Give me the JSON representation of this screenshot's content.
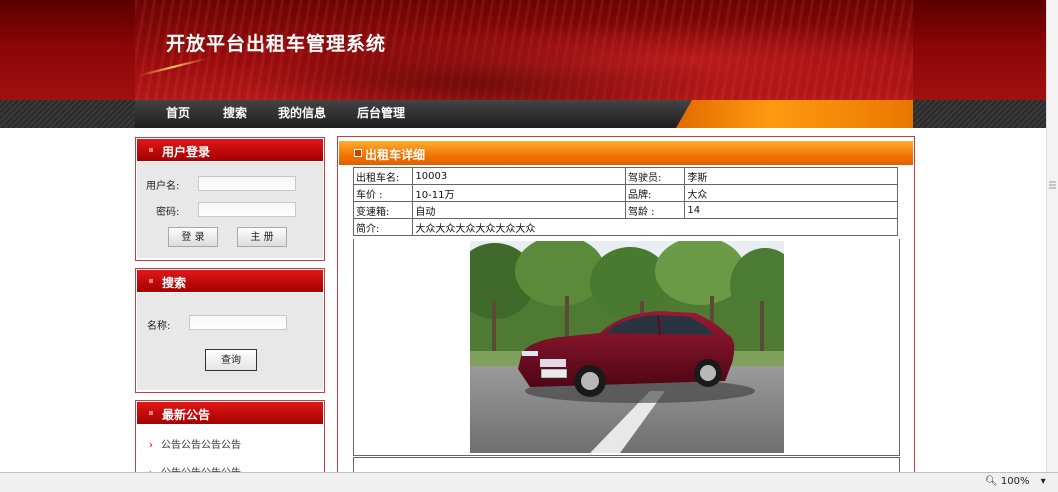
{
  "site": {
    "title": "开放平台出租车管理系统"
  },
  "nav": {
    "items": [
      "首页",
      "搜索",
      "我的信息",
      "后台管理"
    ]
  },
  "login": {
    "title": "用户登录",
    "username_label": "用户名:",
    "password_label": "密码:",
    "login_button": "登 录",
    "register_button": "主 册"
  },
  "search": {
    "title": "搜索",
    "name_label": "名称:",
    "query_button": "查询"
  },
  "notices": {
    "title": "最新公告",
    "items": [
      "公告公告公告公告",
      "公告公告公告公告"
    ]
  },
  "detail": {
    "title": "出租车详细",
    "rows": [
      [
        "出租车名:",
        "10003",
        "驾驶员:",
        "李斯"
      ],
      [
        "车价 :",
        "10-11万",
        "品牌:",
        "大众"
      ],
      [
        "变速箱:",
        "自动",
        "驾龄 :",
        "14"
      ]
    ],
    "intro_label": "简介:",
    "intro_value": "大众大众大众大众大众大众"
  },
  "statusbar": {
    "zoom": "100%"
  },
  "colors": {
    "brand_red": "#a40000",
    "accent_orange": "#f07400",
    "nav_dark": "#2a2a2a"
  }
}
